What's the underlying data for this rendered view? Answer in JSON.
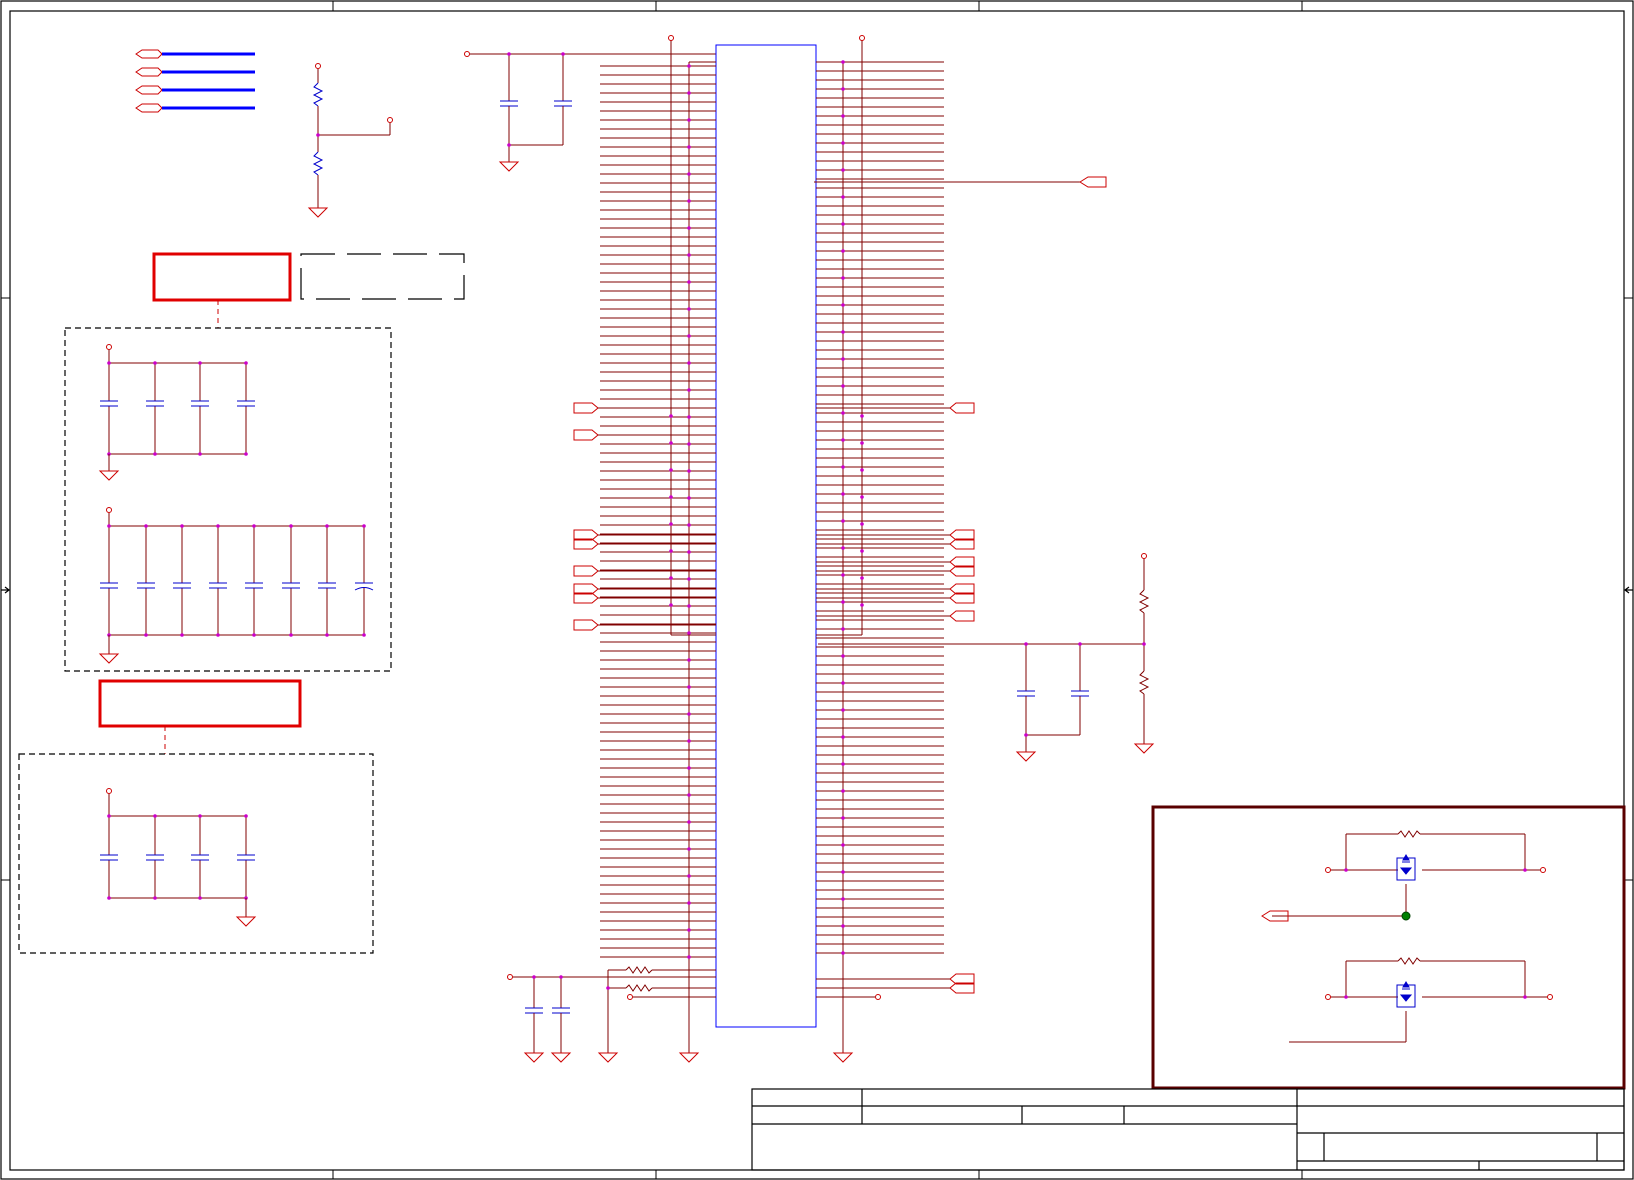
{
  "sheet": {
    "grid_columns": 5,
    "grid_rows": 4
  },
  "colors": {
    "border": "#000000",
    "wire": "#800000",
    "wire_bright": "#cc0000",
    "component": "#cc0000",
    "symbol": "#0000cc",
    "bus": "#0000ff",
    "junction": "#cc00cc",
    "highlight_box": "#e00000",
    "protection_frame": "#5a0000",
    "net_dot": "#008000"
  },
  "title_block": {
    "title": "",
    "sheet_number": "",
    "revision": ""
  }
}
